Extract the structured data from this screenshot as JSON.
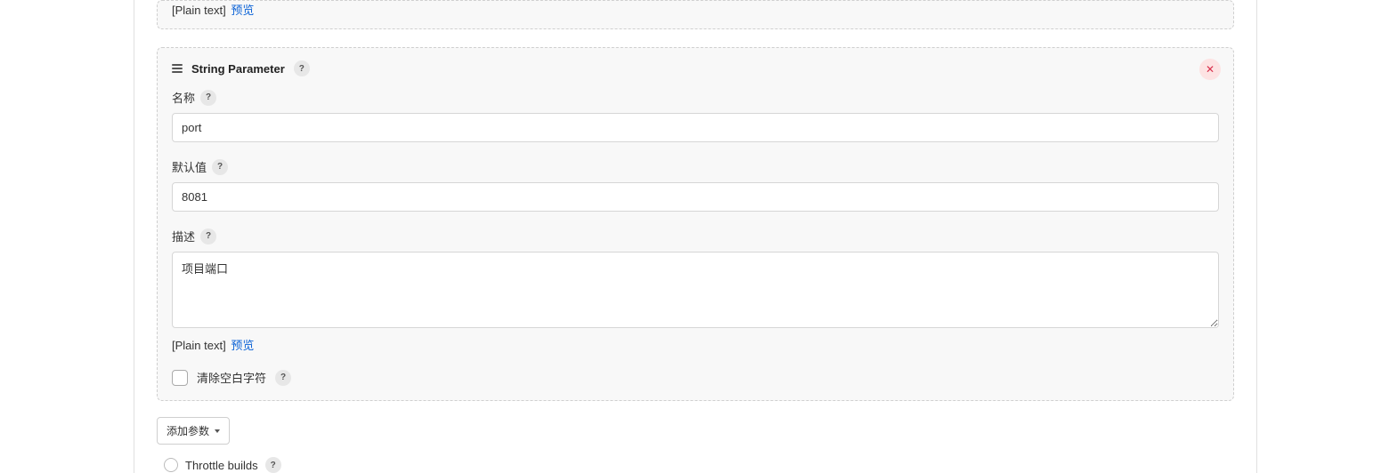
{
  "prev_panel": {
    "plain_text_prefix": "[Plain text]",
    "preview_label": "预览"
  },
  "parameter": {
    "title": "String Parameter",
    "help": "?",
    "close_glyph": "✕",
    "name": {
      "label": "名称",
      "help": "?",
      "value": "port"
    },
    "default": {
      "label": "默认值",
      "help": "?",
      "value": "8081"
    },
    "description": {
      "label": "描述",
      "help": "?",
      "value": "项目端口",
      "plain_text_prefix": "[Plain text]",
      "preview_label": "预览"
    },
    "trim": {
      "label": "清除空白字符",
      "help": "?"
    }
  },
  "add_param_label": "添加参数",
  "throttle": {
    "label": "Throttle builds",
    "help": "?"
  }
}
